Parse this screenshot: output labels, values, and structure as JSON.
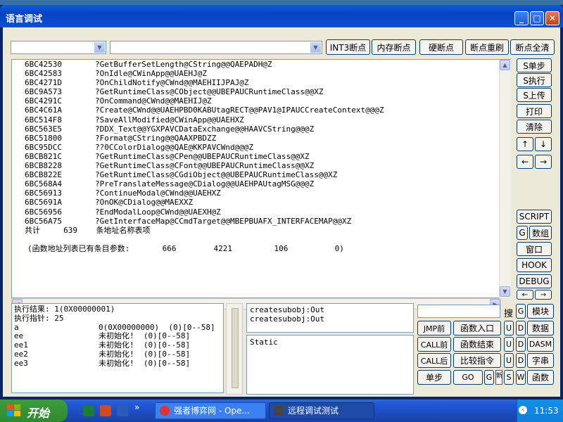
{
  "window": {
    "title": "语言调试"
  },
  "toolbar": {
    "combo1_value": "",
    "combo2_value": "",
    "buttons": [
      "INT3断点",
      "内存断点",
      "硬断点",
      "断点重刷",
      "断点全清"
    ]
  },
  "right_buttons": {
    "s_step": "S单步",
    "s_exec": "S执行",
    "s_upload": "S上传",
    "print": "打印",
    "clear": "清除",
    "up": "↑",
    "down": "↓",
    "left": "←",
    "right": "→",
    "script": "SCRIPT",
    "g": "G",
    "data_group": "数组",
    "window_btn": "窗口",
    "hook": "HOOK",
    "debug": "DEBUG",
    "left2": "←",
    "right2": "→"
  },
  "listing": {
    "rows": [
      {
        "addr": "6BC42530",
        "sym": "?GetBufferSetLength@CString@@QAEPADH@Z"
      },
      {
        "addr": "6BC42583",
        "sym": "?OnIdle@CWinApp@@UAEHJ@Z"
      },
      {
        "addr": "6BC4271D",
        "sym": "?OnChildNotify@CWnd@@MAEHIIJPAJ@Z"
      },
      {
        "addr": "6BC9A573",
        "sym": "?GetRuntimeClass@CObject@@UBEPAUCRuntimeClass@@XZ"
      },
      {
        "addr": "6BC4291C",
        "sym": "?OnCommand@CWnd@@MAEHIJ@Z"
      },
      {
        "addr": "6BC4C61A",
        "sym": "?Create@CWnd@@UAEHPBD0KABUtagRECT@@PAV1@IPAUCCreateContext@@@Z"
      },
      {
        "addr": "6BC514F8",
        "sym": "?SaveAllModified@CWinApp@@UAEHXZ"
      },
      {
        "addr": "6BC563E5",
        "sym": "?DDX_Text@@YGXPAVCDataExchange@@HAAVCString@@@Z"
      },
      {
        "addr": "6BC51800",
        "sym": "?Format@CString@@QAAXPBDZZ"
      },
      {
        "addr": "6BC95DCC",
        "sym": "??0CColorDialog@@QAE@KKPAVCWnd@@@Z"
      },
      {
        "addr": "6BCB821C",
        "sym": "?GetRuntimeClass@CPen@@UBEPAUCRuntimeClass@@XZ"
      },
      {
        "addr": "6BCB8228",
        "sym": "?GetRuntimeClass@CFont@@UBEPAUCRuntimeClass@@XZ"
      },
      {
        "addr": "6BCB822E",
        "sym": "?GetRuntimeClass@CGdiObject@@UBEPAUCRuntimeClass@@XZ"
      },
      {
        "addr": "6BC568A4",
        "sym": "?PreTranslateMessage@CDialog@@UAEHPAUtagMSG@@@Z"
      },
      {
        "addr": "6BC56913",
        "sym": "?ContinueModal@CWnd@@UAEHXZ"
      },
      {
        "addr": "6BC5691A",
        "sym": "?OnOK@CDialog@@MAEXXZ"
      },
      {
        "addr": "6BC56956",
        "sym": "?EndModalLoop@CWnd@@UAEXH@Z"
      },
      {
        "addr": "6BC56A75",
        "sym": "?GetInterfaceMap@CCmdTarget@@MBEPBUAFX_INTERFACEMAP@@XZ"
      }
    ],
    "total_line": "共计     639    条地址名称表项",
    "summary_line": "(函数地址列表已有条目参数:       666        4221         106          0)"
  },
  "result": {
    "line1": "执行结果:  1(0X00000001)",
    "line2": "执行指针: 25",
    "vars": [
      {
        "name": "a",
        "value": "0(0X00000000)  (0)[0--58]"
      },
      {
        "name": "ee",
        "value": "未初始化!  (0)[0--58]"
      },
      {
        "name": "ee1",
        "value": "未初始化!  (0)[0--58]"
      },
      {
        "name": "ee2",
        "value": "未初始化!  (0)[0--58]"
      },
      {
        "name": "ee3",
        "value": "未初始化!  (0)[0--58]"
      }
    ]
  },
  "output": {
    "lines": [
      "createsubobj:Out",
      "createsubobj:Out"
    ]
  },
  "static_text": "Static",
  "search": {
    "value": "",
    "button": "搜"
  },
  "bottom_right": {
    "g": "G",
    "module": "模块",
    "jmp_prev": "JMP前",
    "func_entry": "函数入口",
    "u1": "U",
    "d1": "D",
    "data": "数据",
    "call_prev": "CALL前",
    "func_end": "函数结束",
    "u2": "U",
    "d2": "D",
    "dasm": "DASM",
    "call_next": "CALL后",
    "compare": "比较指令",
    "u3": "U",
    "d3": "D",
    "string": "字串",
    "single_step": "单步",
    "go": "GO",
    "g2": "G",
    "s": "S",
    "w": "W",
    "func": "函数"
  },
  "taskbar": {
    "start": "开始",
    "tasks": [
      "强者博弈网 - Ope...",
      "远程调试测试"
    ],
    "clock": "11:53"
  },
  "colors": {
    "title_blue": "#0a4fd6",
    "window_bg": "#ece9d8",
    "taskbar_blue": "#2157d9",
    "start_green": "#3c9c3c",
    "tray_blue": "#0f7fd8"
  }
}
